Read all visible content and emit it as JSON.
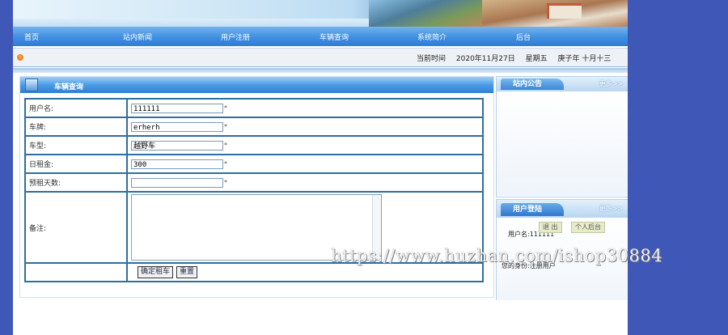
{
  "nav": [
    "首页",
    "站内新闻",
    "用户注册",
    "车辆查询",
    "系统简介",
    "后台"
  ],
  "infobar": {
    "time_label": "当前时间",
    "date": "2020年11月27日",
    "weekday": "星期五",
    "lunar": "庚子年 十月十三"
  },
  "panel": {
    "title": "车辆查询",
    "fields": [
      {
        "label": "用户名:",
        "value": "111111",
        "star": "*"
      },
      {
        "label": "车牌:",
        "value": "erherh",
        "star": "*"
      },
      {
        "label": "车型:",
        "value": "越野车",
        "star": "*"
      },
      {
        "label": "日租金:",
        "value": "300",
        "star": "*"
      },
      {
        "label": "预租天数:",
        "value": "",
        "star": "*"
      }
    ],
    "remark_label": "备注:",
    "remark_value": "",
    "submit": "确定租车",
    "reset": "重置"
  },
  "notice": {
    "title": "站内公告",
    "more": "更多>>"
  },
  "login": {
    "title": "用户登陆",
    "more": "更多>>",
    "username_line": "用户名:111111",
    "role_line": "您的身份:注册用户",
    "logout": "退 出",
    "personal": "个人后台"
  },
  "watermark": "https://www.huzhan.com/ishop30884"
}
